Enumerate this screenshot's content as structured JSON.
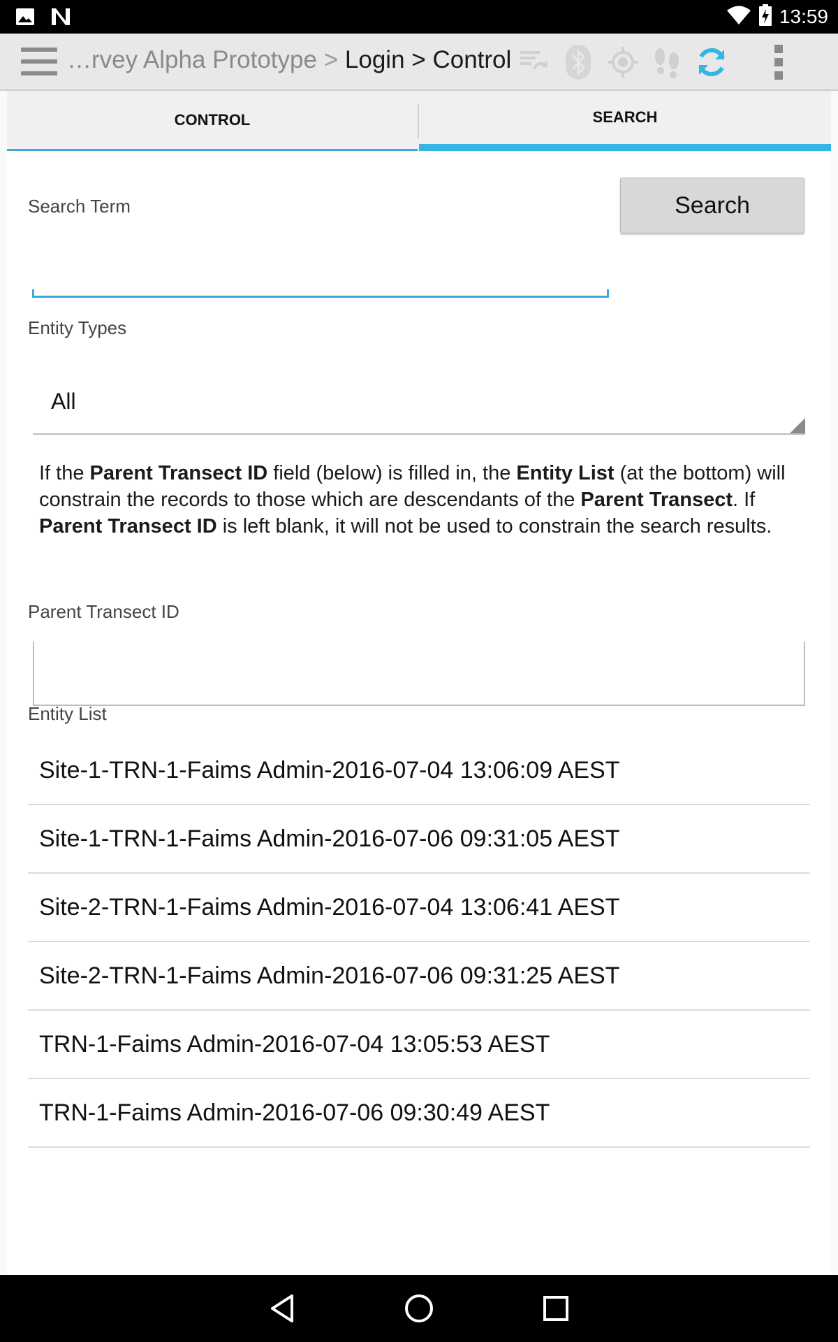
{
  "status_bar": {
    "time": "13:59",
    "icons": [
      "image-icon",
      "n-logo-icon",
      "wifi-icon",
      "battery-charging-icon"
    ]
  },
  "action_bar": {
    "breadcrumb": {
      "module": "…rvey Alpha Prototype",
      "separator": ">",
      "step1": "Login",
      "step2": "Control"
    },
    "icons": [
      "sync-status-icon",
      "bluetooth-icon",
      "gps-icon",
      "tracking-icon",
      "sync-icon",
      "overflow-menu-icon"
    ],
    "accent": "#34b5e5"
  },
  "tabs": [
    {
      "label": "CONTROL",
      "selected": false
    },
    {
      "label": "SEARCH",
      "selected": true
    }
  ],
  "search": {
    "term_label": "Search Term",
    "button_label": "Search",
    "term_value": ""
  },
  "entity_types": {
    "label": "Entity Types",
    "selected": "All"
  },
  "info": {
    "p1": "If the ",
    "b1": "Parent Transect ID",
    "p2": " field (below) is filled in, the ",
    "b2": "Entity List",
    "p3": " (at the bottom) will constrain the records to those which are descendants of the ",
    "b3": "Parent Transect",
    "p4": ". If ",
    "b4": "Parent Transect ID",
    "p5": " is left blank, it will not be used to constrain the search results."
  },
  "parent_transect": {
    "label": "Parent Transect ID",
    "value": ""
  },
  "entity_list": {
    "label": "Entity List",
    "items": [
      "Site-1-TRN-1-Faims Admin-2016-07-04 13:06:09 AEST",
      "Site-1-TRN-1-Faims Admin-2016-07-06 09:31:05 AEST",
      "Site-2-TRN-1-Faims Admin-2016-07-04 13:06:41 AEST",
      "Site-2-TRN-1-Faims Admin-2016-07-06 09:31:25 AEST",
      "TRN-1-Faims Admin-2016-07-04 13:05:53 AEST",
      "TRN-1-Faims Admin-2016-07-06 09:30:49 AEST"
    ]
  },
  "nav_bar": {
    "icons": [
      "back-icon",
      "home-icon",
      "recents-icon"
    ]
  }
}
